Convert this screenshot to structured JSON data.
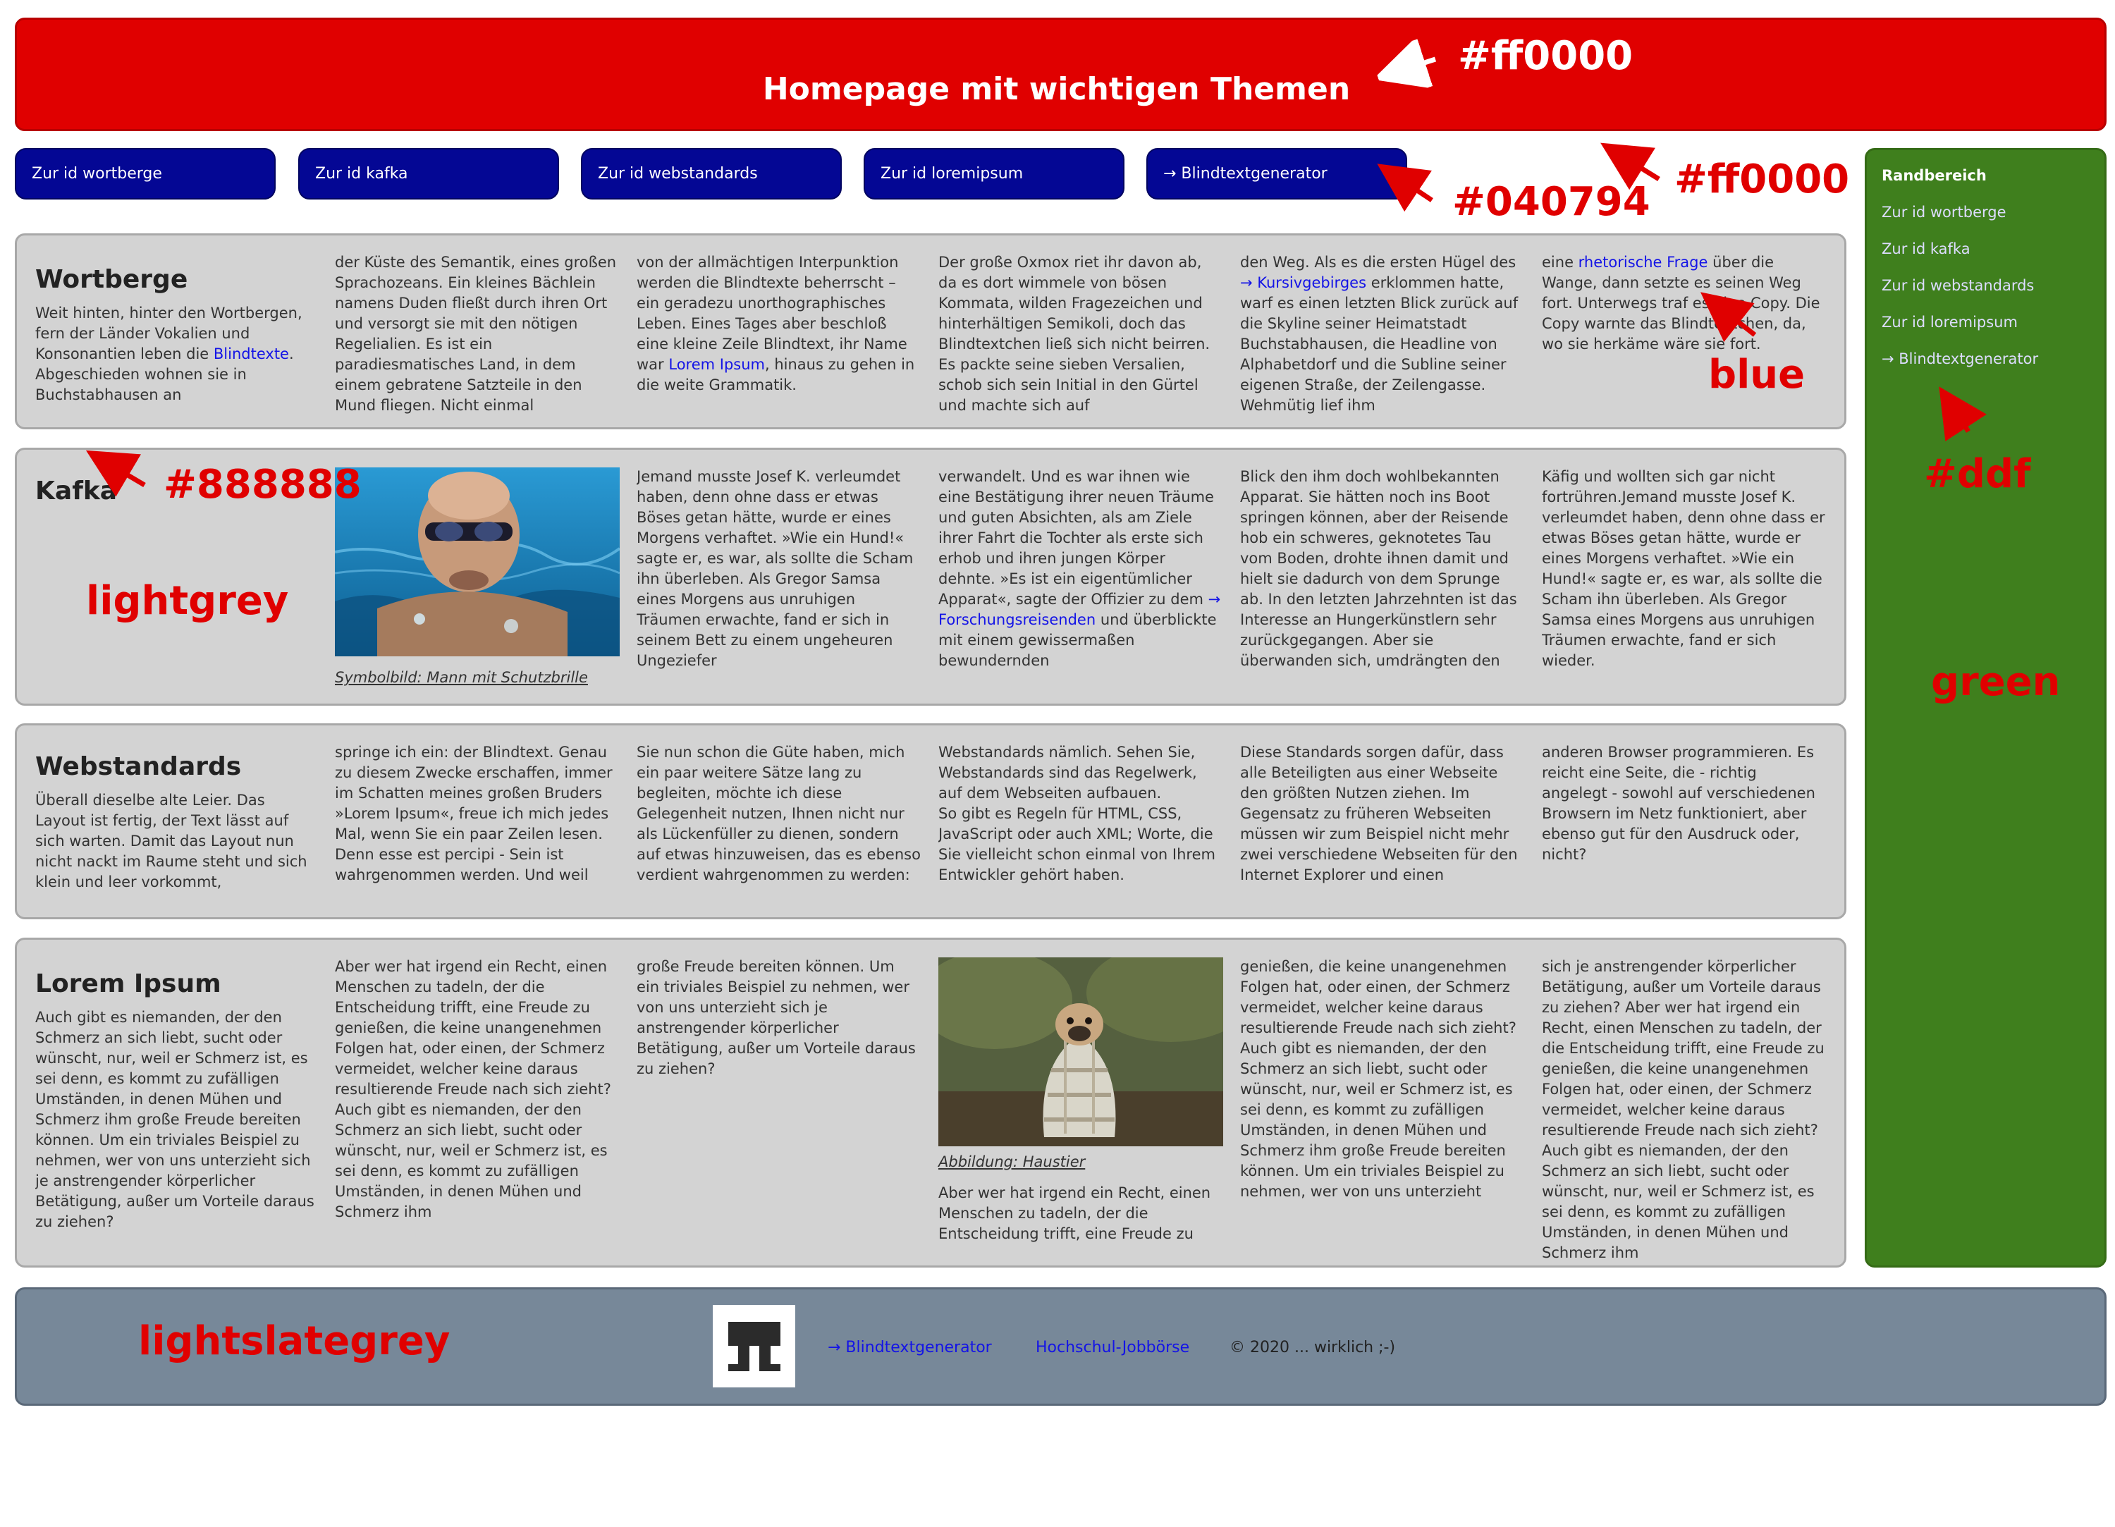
{
  "header": {
    "title": "Homepage mit wichtigen Themen"
  },
  "nav": [
    {
      "label": "Zur id wortberge"
    },
    {
      "label": "Zur id kafka"
    },
    {
      "label": "Zur id webstandards"
    },
    {
      "label": "Zur id loremipsum"
    },
    {
      "label": "→ Blindtextgenerator"
    }
  ],
  "articles": {
    "wortberge": {
      "title": "Wortberge",
      "intro_pre": "Weit hinten, hinter den Wortbergen, fern der Länder Vokalien und Konsonantien leben die ",
      "intro_link": "Blindtexte",
      "intro_post": ". Abgeschieden wohnen sie in Buchstabhausen an",
      "col2": "der Küste des Semantik, eines großen Sprachozeans. Ein kleines Bächlein namens Duden fließt durch ihren Ort und versorgt sie mit den nötigen Regelialien. Es ist ein paradiesmatisches Land, in dem einem gebratene Satzteile in den Mund fliegen. Nicht einmal",
      "col3_pre": "von der allmächtigen Interpunktion werden die Blindtexte beherrscht – ein geradezu unorthographisches Leben. Eines Tages aber beschloß eine kleine Zeile Blindtext, ihr Name war ",
      "col3_link": "Lorem Ipsum",
      "col3_post": ", hinaus zu gehen in die weite Grammatik.",
      "col4": "Der große Oxmox riet ihr davon ab, da es dort wimmele von bösen Kommata, wilden Fragezeichen und hinterhältigen Semikoli, doch das Blindtextchen ließ sich nicht beirren. Es packte seine sieben Versalien, schob sich sein Initial in den Gürtel und machte sich auf",
      "col5_pre": "den Weg. Als es die ersten Hügel des ",
      "col5_link": "→ Kursivgebirges",
      "col5_post": " erklommen hatte, warf es einen letzten Blick zurück auf die Skyline seiner Heimatstadt Buchstabhausen, die Headline von Alphabetdorf und die Subline seiner eigenen Straße, der Zeilengasse. Wehmütig lief ihm",
      "col6_pre": "eine ",
      "col6_link": "rhetorische Frage",
      "col6_post": " über die Wange, dann setzte es seinen Weg fort. Unterwegs traf es eine Copy. Die Copy warnte das Blindtextchen, da, wo sie herkäme wäre sie fort."
    },
    "kafka": {
      "title": "Kafka",
      "caption": "Symbolbild: Mann mit Schutzbrille",
      "col3": "Jemand musste Josef K. verleumdet haben, denn ohne dass er etwas Böses getan hätte, wurde er eines Morgens verhaftet. »Wie ein Hund!« sagte er, es war, als sollte die Scham ihn überleben. Als Gregor Samsa eines Morgens aus unruhigen Träumen erwachte, fand er sich in seinem Bett zu einem ungeheuren Ungeziefer",
      "col4_pre": "verwandelt. Und es war ihnen wie eine Bestätigung ihrer neuen Träume und guten Absichten, als am Ziele ihrer Fahrt die Tochter als erste sich erhob und ihren jungen Körper dehnte. »Es ist ein eigentümlicher Apparat«, sagte der Offizier zu dem ",
      "col4_link": "→ Forschungsreisenden",
      "col4_post": " und überblickte mit einem gewissermaßen bewundernden",
      "col5": "Blick den ihm doch wohlbekannten Apparat. Sie hätten noch ins Boot springen können, aber der Reisende hob ein schweres, geknotetes Tau vom Boden, drohte ihnen damit und hielt sie dadurch von dem Sprunge ab. In den letzten Jahrzehnten ist das Interesse an Hungerkünstlern sehr zurückgegangen. Aber sie überwanden sich, umdrängten den",
      "col6": "Käfig und wollten sich gar nicht fortrühren.Jemand musste Josef K. verleumdet haben, denn ohne dass er etwas Böses getan hätte, wurde er eines Morgens verhaftet. »Wie ein Hund!« sagte er, es war, als sollte die Scham ihn überleben. Als Gregor Samsa eines Morgens aus unruhigen Träumen erwachte, fand er sich wieder."
    },
    "webstandards": {
      "title": "Webstandards",
      "intro": "Überall dieselbe alte Leier. Das Layout ist fertig, der Text lässt auf sich warten. Damit das Layout nun nicht nackt im Raume steht und sich klein und leer vorkommt,",
      "col2": "springe ich ein: der Blindtext. Genau zu diesem Zwecke erschaffen, immer im Schatten meines großen Bruders »Lorem Ipsum«, freue ich mich jedes Mal, wenn Sie ein paar Zeilen lesen. Denn esse est percipi - Sein ist wahrgenommen werden. Und weil",
      "col3": "Sie nun schon die Güte haben, mich ein paar weitere Sätze lang zu begleiten, möchte ich diese Gelegenheit nutzen, Ihnen nicht nur als Lückenfüller zu dienen, sondern auf etwas hinzuweisen, das es ebenso verdient wahrgenommen zu werden:",
      "col4a": "Webstandards nämlich. Sehen Sie, Webstandards sind das Regelwerk, auf dem Webseiten aufbauen.",
      "col4b": "So gibt es Regeln für HTML, CSS, JavaScript oder auch XML; Worte, die Sie vielleicht schon einmal von Ihrem Entwickler gehört haben.",
      "col5": "Diese Standards sorgen dafür, dass alle Beteiligten aus einer Webseite den größten Nutzen ziehen. Im Gegensatz zu früheren Webseiten müssen wir zum Beispiel nicht mehr zwei verschiedene Webseiten für den Internet Explorer und einen",
      "col6": "anderen Browser programmieren. Es reicht eine Seite, die - richtig angelegt - sowohl auf verschiedenen Browsern im Netz funktioniert, aber ebenso gut für den Ausdruck oder, nicht?"
    },
    "loremipsum": {
      "title": "Lorem Ipsum",
      "intro": "Auch gibt es niemanden, der den Schmerz an sich liebt, sucht oder wünscht, nur, weil er Schmerz ist, es sei denn, es kommt zu zufälligen Umständen, in denen Mühen und Schmerz ihm große Freude bereiten können. Um ein triviales Beispiel zu nehmen, wer von uns unterzieht sich je anstrengender körperlicher Betätigung, außer um Vorteile daraus zu ziehen?",
      "col2": "Aber wer hat irgend ein Recht, einen Menschen zu tadeln, der die Entscheidung trifft, eine Freude zu genießen, die keine unangenehmen Folgen hat, oder einen, der Schmerz vermeidet, welcher keine daraus resultierende Freude nach sich zieht? Auch gibt es niemanden, der den Schmerz an sich liebt, sucht oder wünscht, nur, weil er Schmerz ist, es sei denn, es kommt zu zufälligen Umständen, in denen Mühen und Schmerz ihm",
      "col3": "große Freude bereiten können. Um ein triviales Beispiel zu nehmen, wer von uns unterzieht sich je anstrengender körperlicher Betätigung, außer um Vorteile daraus zu ziehen?",
      "caption": "Abbildung: Haustier",
      "col4_after": "Aber wer hat irgend ein Recht, einen Menschen zu tadeln, der die Entscheidung trifft, eine Freude zu",
      "col5": "genießen, die keine unangenehmen Folgen hat, oder einen, der Schmerz vermeidet, welcher keine daraus resultierende Freude nach sich zieht? Auch gibt es niemanden, der den Schmerz an sich liebt, sucht oder wünscht, nur, weil er Schmerz ist, es sei denn, es kommt zu zufälligen Umständen, in denen Mühen und Schmerz ihm große Freude bereiten können. Um ein triviales Beispiel zu nehmen, wer von uns unterzieht",
      "col6": "sich je anstrengender körperlicher Betätigung, außer um Vorteile daraus zu ziehen? Aber wer hat irgend ein Recht, einen Menschen zu tadeln, der die Entscheidung trifft, eine Freude zu genießen, die keine unangenehmen Folgen hat, oder einen, der Schmerz vermeidet, welcher keine daraus resultierende Freude nach sich zieht? Auch gibt es niemanden, der den Schmerz an sich liebt, sucht oder wünscht, nur, weil er Schmerz ist, es sei denn, es kommt zu zufälligen Umständen, in denen Mühen und Schmerz ihm"
    }
  },
  "sidebar": {
    "title": "Randbereich",
    "items": [
      "Zur id wortberge",
      "Zur id kafka",
      "Zur id webstandards",
      "Zur id loremipsum",
      "→ Blindtextgenerator"
    ]
  },
  "footer": {
    "link1": "→ Blindtextgenerator",
    "link2": "Hochschul-Jobbörse",
    "copyright": "© 2020 ... wirklich ;-)"
  },
  "annotations": {
    "header_color": "#ff0000",
    "nav_color": "#040794",
    "nav_border_color": "#ff0000",
    "link_color": "blue",
    "sidebar_link_color": "#ddf",
    "article_border_color": "#888888",
    "article_bg": "lightgrey",
    "sidebar_bg": "green",
    "footer_bg": "lightslategrey"
  },
  "colors": {
    "header": "#e00000",
    "nav": "#040794",
    "article": "#d3d3d3",
    "sidebar": "#3f7f1d",
    "footer": "#778899",
    "link": "#1414e6",
    "annotation": "#e00000"
  }
}
